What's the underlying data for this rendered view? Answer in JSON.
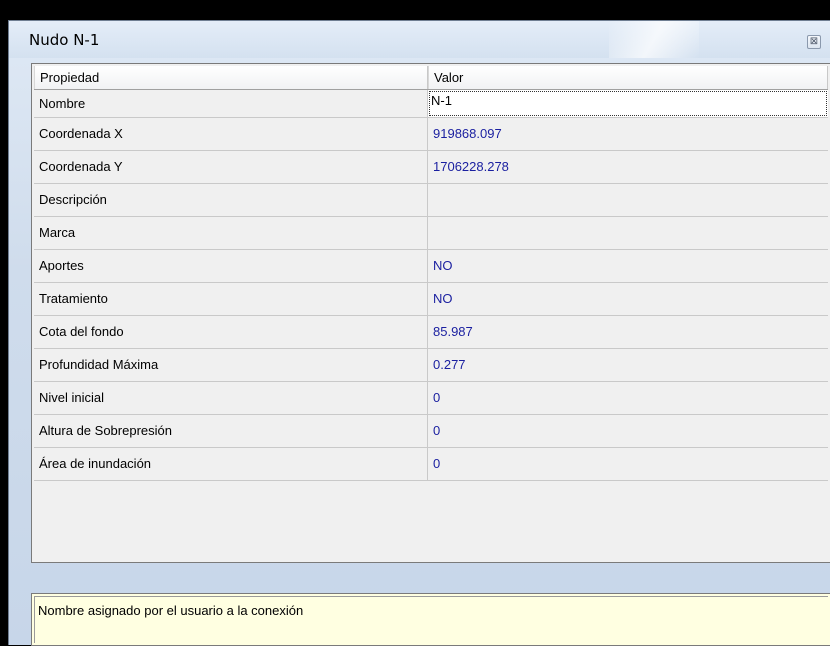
{
  "window": {
    "title": "Nudo N-1",
    "close_glyph": "⊠"
  },
  "grid": {
    "header_property": "Propiedad",
    "header_value": "Valor",
    "rows": [
      {
        "property": "Nombre",
        "value": "N-1"
      },
      {
        "property": "Coordenada X",
        "value": "919868.097"
      },
      {
        "property": "Coordenada Y",
        "value": "1706228.278"
      },
      {
        "property": "Descripción",
        "value": ""
      },
      {
        "property": "Marca",
        "value": ""
      },
      {
        "property": "Aportes",
        "value": "NO"
      },
      {
        "property": "Tratamiento",
        "value": "NO"
      },
      {
        "property": "Cota del fondo",
        "value": "85.987"
      },
      {
        "property": "Profundidad Máxima",
        "value": "0.277"
      },
      {
        "property": "Nivel inicial",
        "value": "0"
      },
      {
        "property": "Altura de Sobrepresión",
        "value": "0"
      },
      {
        "property": "Área de inundación",
        "value": "0"
      }
    ]
  },
  "description": {
    "text": "Nombre asignado por el usuario a la conexión"
  },
  "colors": {
    "value_text": "#1a1fa0",
    "description_background": "#ffffe1",
    "grid_background": "#f0f0f0"
  }
}
